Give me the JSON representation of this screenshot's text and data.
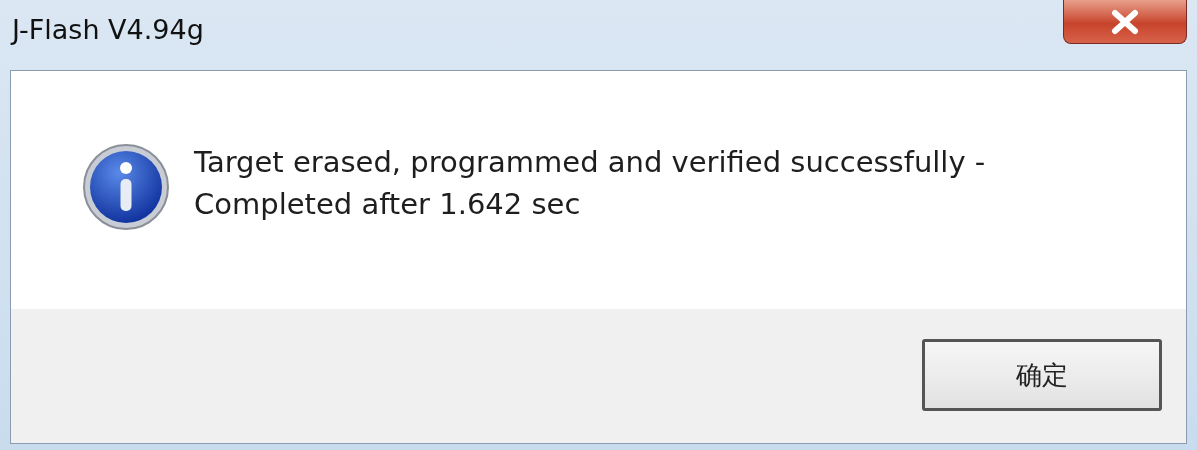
{
  "window": {
    "title": "J-Flash V4.94g"
  },
  "message": {
    "lines": [
      "Target erased, programmed and verified successfully -",
      "Completed after 1.642 sec"
    ]
  },
  "buttons": [
    {
      "label": "确定",
      "selected": true
    }
  ]
}
